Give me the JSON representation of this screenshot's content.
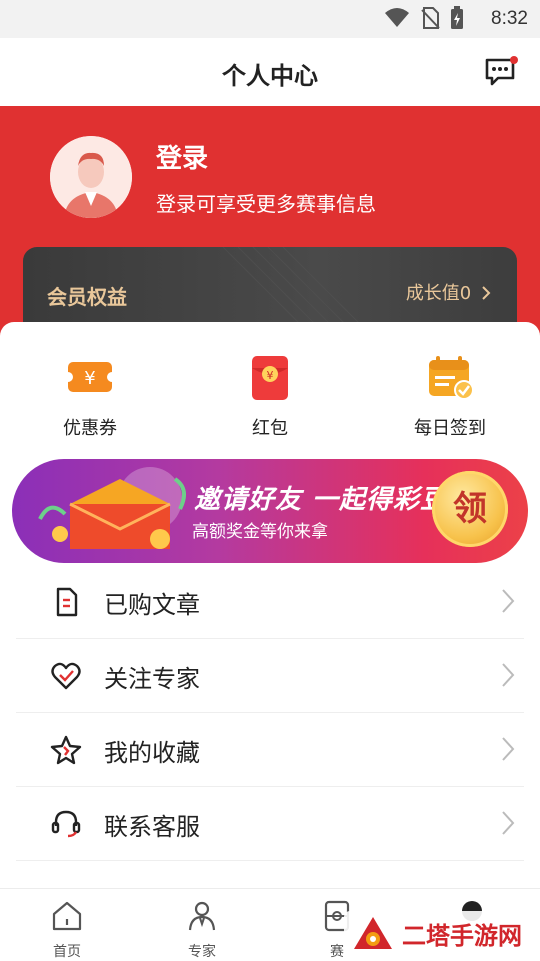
{
  "status_bar": {
    "time": "8:32"
  },
  "nav": {
    "title": "个人中心",
    "message_icon": "chat-icon"
  },
  "profile": {
    "title": "登录",
    "subtitle": "登录可享受更多赛事信息"
  },
  "member": {
    "label": "会员权益",
    "growth": "成长值0"
  },
  "quick_actions": [
    {
      "label": "优惠券",
      "icon": "coupon-icon"
    },
    {
      "label": "红包",
      "icon": "red-packet-icon"
    },
    {
      "label": "每日签到",
      "icon": "calendar-check-icon"
    }
  ],
  "banner": {
    "title": "邀请好友 一起得彩豆",
    "subtitle": "高额奖金等你来拿",
    "button": "领"
  },
  "menu": [
    {
      "label": "已购文章",
      "icon": "document-icon"
    },
    {
      "label": "关注专家",
      "icon": "heart-check-icon"
    },
    {
      "label": "我的收藏",
      "icon": "star-icon"
    },
    {
      "label": "联系客服",
      "icon": "headset-icon"
    }
  ],
  "tabs": [
    {
      "label": "首页",
      "icon": "home-icon"
    },
    {
      "label": "专家",
      "icon": "expert-icon"
    },
    {
      "label": "赛",
      "icon": "match-icon"
    },
    {
      "label": "",
      "icon": "profile-icon"
    }
  ],
  "watermark": {
    "text": "二塔手游网"
  },
  "colors": {
    "primary": "#e03131",
    "gold": "#e9c79a"
  }
}
